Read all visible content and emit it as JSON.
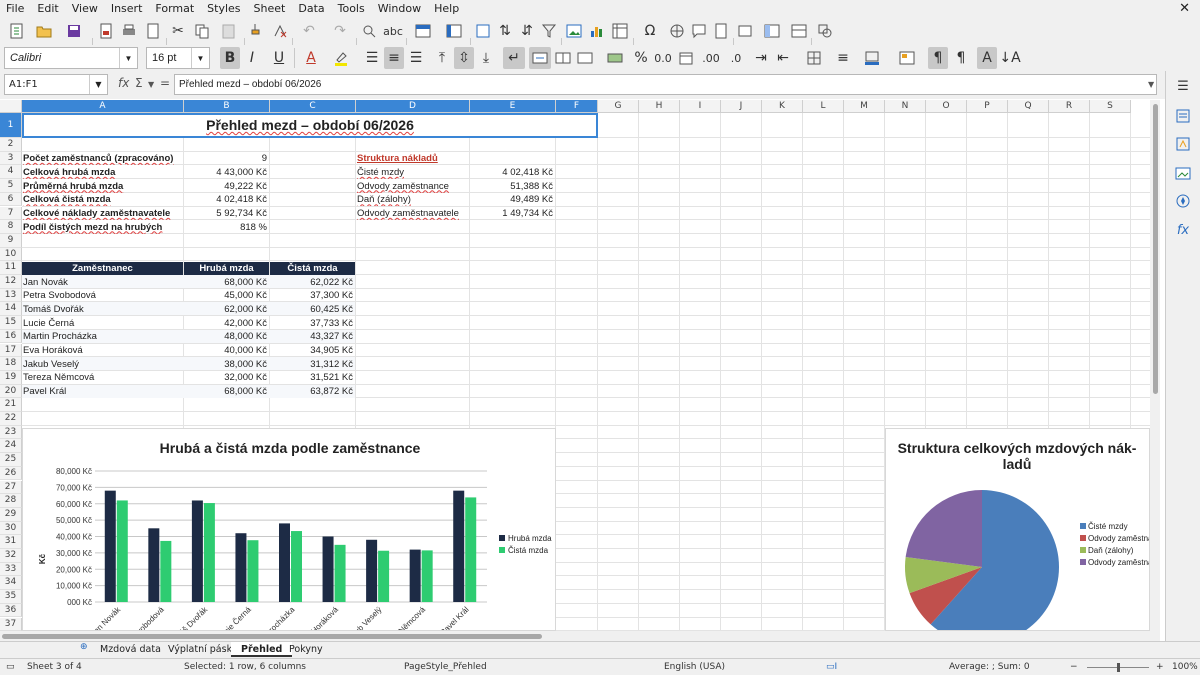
{
  "menu": [
    "File",
    "Edit",
    "View",
    "Insert",
    "Format",
    "Styles",
    "Sheet",
    "Data",
    "Tools",
    "Window",
    "Help"
  ],
  "toolbar": {
    "font_name": "Calibri",
    "font_size": "16 pt",
    "bold_label": "B",
    "italic_label": "I",
    "underline_label": "U",
    "percent_label": "%",
    "decimal_label": "0.0",
    "add_decimal_label": ".00",
    "remove_decimal_label": ".0"
  },
  "formula_bar": {
    "name_box": "A1:F1",
    "content": "Přehled mezd – období 06/2026"
  },
  "columns": [
    {
      "label": "A",
      "sel": true
    },
    {
      "label": "B",
      "sel": true
    },
    {
      "label": "C",
      "sel": true
    },
    {
      "label": "D",
      "sel": true
    },
    {
      "label": "E",
      "sel": true
    },
    {
      "label": "F",
      "sel": true
    },
    {
      "label": "G"
    },
    {
      "label": "H"
    },
    {
      "label": "I"
    },
    {
      "label": "J"
    },
    {
      "label": "K"
    },
    {
      "label": "L"
    },
    {
      "label": "M"
    },
    {
      "label": "N"
    },
    {
      "label": "O"
    },
    {
      "label": "P"
    },
    {
      "label": "Q"
    },
    {
      "label": "R"
    },
    {
      "label": "S"
    }
  ],
  "rows": [
    "1",
    "2",
    "3",
    "4",
    "5",
    "6",
    "7",
    "8",
    "9",
    "10",
    "11",
    "12",
    "13",
    "14",
    "15",
    "16",
    "17",
    "18",
    "19",
    "20",
    "21",
    "22",
    "23",
    "24",
    "25",
    "26",
    "27",
    "28",
    "29",
    "30",
    "31",
    "32",
    "33",
    "34",
    "35",
    "36",
    "37"
  ],
  "sheet": {
    "title": "Přehled mezd – období 06/2026",
    "summary": [
      {
        "label": "Počet zaměstnanců (zpracováno)",
        "value": "9"
      },
      {
        "label": "Celková hrubá mzda",
        "value": "4 43,000 Kč"
      },
      {
        "label": "Průměrná hrubá mzda",
        "value": "49,222 Kč"
      },
      {
        "label": "Celková čistá mzda",
        "value": "4 02,418 Kč"
      },
      {
        "label": "Celkové náklady zaměstnavatele",
        "value": "5 92,734 Kč"
      },
      {
        "label": "Podíl čistých mezd na hrubých",
        "value": "818 %"
      }
    ],
    "cost_title": "Struktura nákladů",
    "costs": [
      {
        "label": "Čisté mzdy",
        "value": "4 02,418 Kč"
      },
      {
        "label": "Odvody zaměstnance",
        "value": "51,388 Kč"
      },
      {
        "label": "Daň (zálohy)",
        "value": "49,489 Kč"
      },
      {
        "label": "Odvody zaměstnavatele",
        "value": "1 49,734 Kč"
      }
    ],
    "table_headers": [
      "Zaměstnanec",
      "Hrubá mzda",
      "Čistá mzda"
    ],
    "employees": [
      {
        "name": "Jan Novák",
        "gross": "68,000 Kč",
        "net": "62,022 Kč"
      },
      {
        "name": "Petra Svobodová",
        "gross": "45,000 Kč",
        "net": "37,300 Kč"
      },
      {
        "name": "Tomáš Dvořák",
        "gross": "62,000 Kč",
        "net": "60,425 Kč"
      },
      {
        "name": "Lucie Černá",
        "gross": "42,000 Kč",
        "net": "37,733 Kč"
      },
      {
        "name": "Martin Procházka",
        "gross": "48,000 Kč",
        "net": "43,327 Kč"
      },
      {
        "name": "Eva Horáková",
        "gross": "40,000 Kč",
        "net": "34,905 Kč"
      },
      {
        "name": "Jakub Veselý",
        "gross": "38,000 Kč",
        "net": "31,312 Kč"
      },
      {
        "name": "Tereza Němcová",
        "gross": "32,000 Kč",
        "net": "31,521 Kč"
      },
      {
        "name": "Pavel Král",
        "gross": "68,000 Kč",
        "net": "63,872 Kč"
      }
    ]
  },
  "chart_data": [
    {
      "type": "bar",
      "title": "Hrubá a čistá mzda podle zaměstnance",
      "ylabel": "Kč",
      "ylim": [
        0,
        80000
      ],
      "yticks": [
        "000 Kč",
        "10,000 Kč",
        "20,000 Kč",
        "30,000 Kč",
        "40,000 Kč",
        "50,000 Kč",
        "60,000 Kč",
        "70,000 Kč",
        "80,000 Kč"
      ],
      "categories": [
        "Jan Novák",
        "Petra Svobodová",
        "Tomáš Dvořák",
        "Lucie Černá",
        "Martin Procházka",
        "Eva Horáková",
        "Jakub Veselý",
        "Tereza Němcová",
        "Pavel Král"
      ],
      "series": [
        {
          "name": "Hrubá mzda",
          "color": "#1d2b45",
          "values": [
            68000,
            45000,
            62000,
            42000,
            48000,
            40000,
            38000,
            32000,
            68000
          ]
        },
        {
          "name": "Čistá mzda",
          "color": "#2ecc71",
          "values": [
            62022,
            37300,
            60425,
            37733,
            43327,
            34905,
            31312,
            31521,
            63872
          ]
        }
      ],
      "legend": "right",
      "grid": true
    },
    {
      "type": "pie",
      "title": "Struktura celkových mzdových nák-ladů",
      "categories": [
        "Čisté mzdy",
        "Odvody zaměstnance",
        "Daň (zálohy)",
        "Odvody zaměstnavatele"
      ],
      "legend_labels": [
        "Čisté mzdy",
        "Odvody zaměstnan",
        "Daň (zálohy)",
        "Odvody zaměstnav"
      ],
      "values": [
        402418,
        51388,
        49489,
        149734
      ],
      "colors": [
        "#4a7ebb",
        "#c0504d",
        "#9bbb59",
        "#8064a2"
      ],
      "legend": "right"
    }
  ],
  "sheet_tabs": [
    "Mzdová data",
    "Výplatní páska",
    "Přehled",
    "Pokyny"
  ],
  "active_tab": "Přehled",
  "status": {
    "sheet": "Sheet 3 of 4",
    "selection": "Selected: 1 row, 6 columns",
    "page_style": "PageStyle_Přehled",
    "language": "English (USA)",
    "sum": "Average: ; Sum: 0",
    "zoom": "100%"
  },
  "accent_color": "#3a86d6"
}
